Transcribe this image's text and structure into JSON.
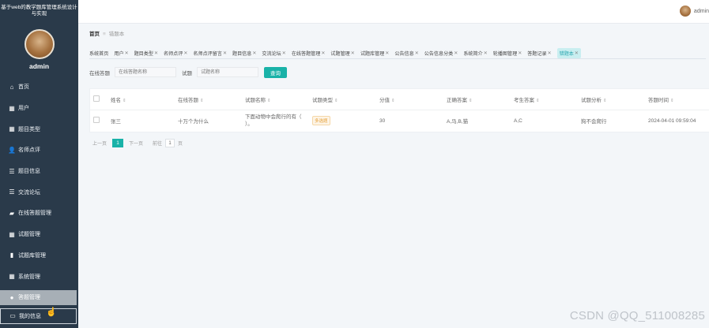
{
  "app": {
    "title": "基于web的教学题库管理系统设计与实现"
  },
  "sidebar": {
    "username": "admin",
    "items": [
      {
        "label": "首页",
        "icon": "home-icon",
        "glyph": "⌂"
      },
      {
        "label": "用户",
        "icon": "grid-icon",
        "glyph": "▦"
      },
      {
        "label": "题目类型",
        "icon": "grid-icon",
        "glyph": "▦"
      },
      {
        "label": "名师点评",
        "icon": "user-icon",
        "glyph": "👤"
      },
      {
        "label": "题目信息",
        "icon": "list-icon",
        "glyph": "☰"
      },
      {
        "label": "交流论坛",
        "icon": "list-icon",
        "glyph": "☰"
      },
      {
        "label": "在线答题管理",
        "icon": "chat-icon",
        "glyph": "▰"
      },
      {
        "label": "试题管理",
        "icon": "grid-icon",
        "glyph": "▦"
      },
      {
        "label": "试题库管理",
        "icon": "chart-icon",
        "glyph": "▮"
      },
      {
        "label": "系统管理",
        "icon": "grid-icon",
        "glyph": "▦"
      },
      {
        "label": "答题管理",
        "icon": "location-icon",
        "glyph": "●"
      },
      {
        "label": "我的信息",
        "icon": "card-icon",
        "glyph": "▭"
      }
    ]
  },
  "topbar": {
    "username": "admin"
  },
  "breadcrumb": {
    "home": "首页",
    "separator": "≡",
    "current": "错题本"
  },
  "tabs": [
    {
      "label": "系统首页",
      "closable": false
    },
    {
      "label": "用户",
      "closable": true
    },
    {
      "label": "题目类型",
      "closable": true
    },
    {
      "label": "名师点评",
      "closable": true
    },
    {
      "label": "名师点评留言",
      "closable": true
    },
    {
      "label": "题目信息",
      "closable": true
    },
    {
      "label": "交流论坛",
      "closable": true
    },
    {
      "label": "在线答题管理",
      "closable": true
    },
    {
      "label": "试题管理",
      "closable": true
    },
    {
      "label": "试题库管理",
      "closable": true
    },
    {
      "label": "公告信息",
      "closable": true
    },
    {
      "label": "公告信息分类",
      "closable": true
    },
    {
      "label": "系统简介",
      "closable": true
    },
    {
      "label": "轮播图管理",
      "closable": true
    },
    {
      "label": "答题记录",
      "closable": true
    },
    {
      "label": "错题本",
      "closable": true
    }
  ],
  "search": {
    "label1": "在线答题",
    "placeholder1": "在线答题名称",
    "label2": "试题",
    "placeholder2": "试题名称",
    "button": "查询"
  },
  "table": {
    "headers": [
      "姓名",
      "在线答题",
      "试题名称",
      "试题类型",
      "分值",
      "正确答案",
      "考生答案",
      "试题分析",
      "答题时间"
    ],
    "rows": [
      {
        "name": "张三",
        "exam": "十万个为什么",
        "question": "下面动物中会爬行的有（ ）。",
        "type": "多选题",
        "score": "30",
        "correct": "A,马,B,猫",
        "answer": "A,C",
        "analysis": "狗不会爬行",
        "time": "2024-04-01 09:59:04"
      }
    ]
  },
  "pager": {
    "prev": "上一页",
    "page": "1",
    "next": "下一页",
    "goto": "前往",
    "goto_value": "1",
    "unit": "页"
  },
  "watermark": "CSDN @QQ_511008285"
}
